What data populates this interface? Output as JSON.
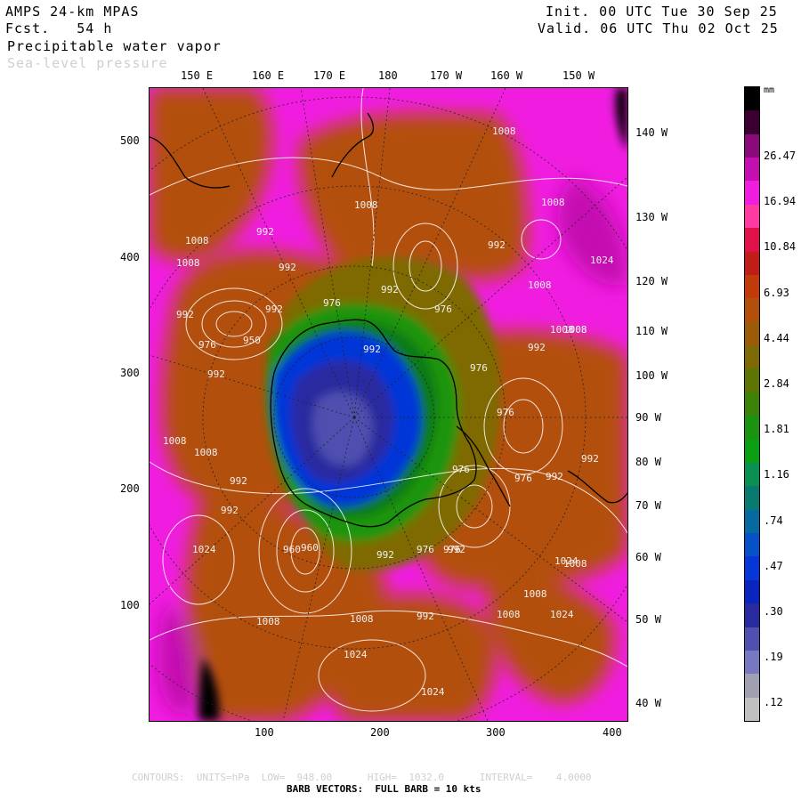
{
  "header": {
    "model": "AMPS 24-km MPAS",
    "forecast": "Fcst.   54 h",
    "field_primary": "Precipitable water vapor",
    "field_secondary": "Sea-level pressure",
    "init": "Init. 00 UTC Tue 30 Sep 25",
    "valid": "Valid. 06 UTC Thu 02 Oct 25"
  },
  "axes": {
    "top_longitudes": [
      "150 E",
      "160 E",
      "170 E",
      "180",
      "170 W",
      "160 W",
      "150 W"
    ],
    "right_longitudes": [
      "140 W",
      "130 W",
      "120 W",
      "110 W",
      "100 W",
      "90 W",
      "80 W",
      "70 W",
      "60 W",
      "50 W",
      "40 W"
    ],
    "left_ticks": [
      "500",
      "400",
      "300",
      "200",
      "100"
    ],
    "bottom_ticks": [
      "100",
      "200",
      "300",
      "400"
    ]
  },
  "colorbar": {
    "unit": "mm",
    "labels": [
      "26.47",
      "16.94",
      "10.84",
      "6.93",
      "4.44",
      "2.84",
      "1.81",
      "1.16",
      ".74",
      ".47",
      ".30",
      ".19",
      ".12"
    ],
    "colors": [
      "#000000",
      "#3a0030",
      "#8a0a7a",
      "#c40fb0",
      "#f01de0",
      "#ff3aa0",
      "#e0104a",
      "#c01c18",
      "#c23a0a",
      "#b34f0c",
      "#9a5a08",
      "#7e6a05",
      "#5e7405",
      "#3a8208",
      "#1a9410",
      "#0aa014",
      "#0a9050",
      "#087a70",
      "#066aa0",
      "#0650c8",
      "#0636d8",
      "#0a24c0",
      "#2a2aa0",
      "#5050b0",
      "#7878c0",
      "#a0a0b0",
      "#c0c0c0"
    ]
  },
  "map": {
    "colors": {
      "background": "#f01de0",
      "magenta_dark": "#c40fb0",
      "orange": "#b34f0c",
      "orange_dark": "#9a4208",
      "olive": "#7e6a05",
      "green": "#1a9410",
      "green_dark": "#0a7a12",
      "blue": "#0636d8",
      "blue_dark": "#2a2aa0",
      "purple": "#5050b0",
      "black": "#000000",
      "contour": "#ffffff"
    },
    "pressure_labels": [
      "1008",
      "1008",
      "992",
      "1008",
      "992",
      "992",
      "1024",
      "976",
      "992",
      "1008",
      "992",
      "1008",
      "1008",
      "992",
      "992",
      "976",
      "992",
      "950",
      "976",
      "992",
      "976",
      "1008",
      "992",
      "1008",
      "1008",
      "992",
      "976",
      "976",
      "960",
      "992",
      "992",
      "976",
      "1024",
      "1008",
      "1008",
      "1024",
      "1008",
      "992",
      "1008",
      "1024",
      "1024",
      "1008",
      "1008",
      "1024",
      "1008",
      "992",
      "976",
      "976",
      "992",
      "960"
    ]
  },
  "footer": {
    "contours": "CONTOURS:  UNITS=hPa  LOW=  948.00      HIGH=  1032.0      INTERVAL=    4.0000",
    "barbs": "BARB VECTORS:  FULL BARB = 10 kts"
  }
}
